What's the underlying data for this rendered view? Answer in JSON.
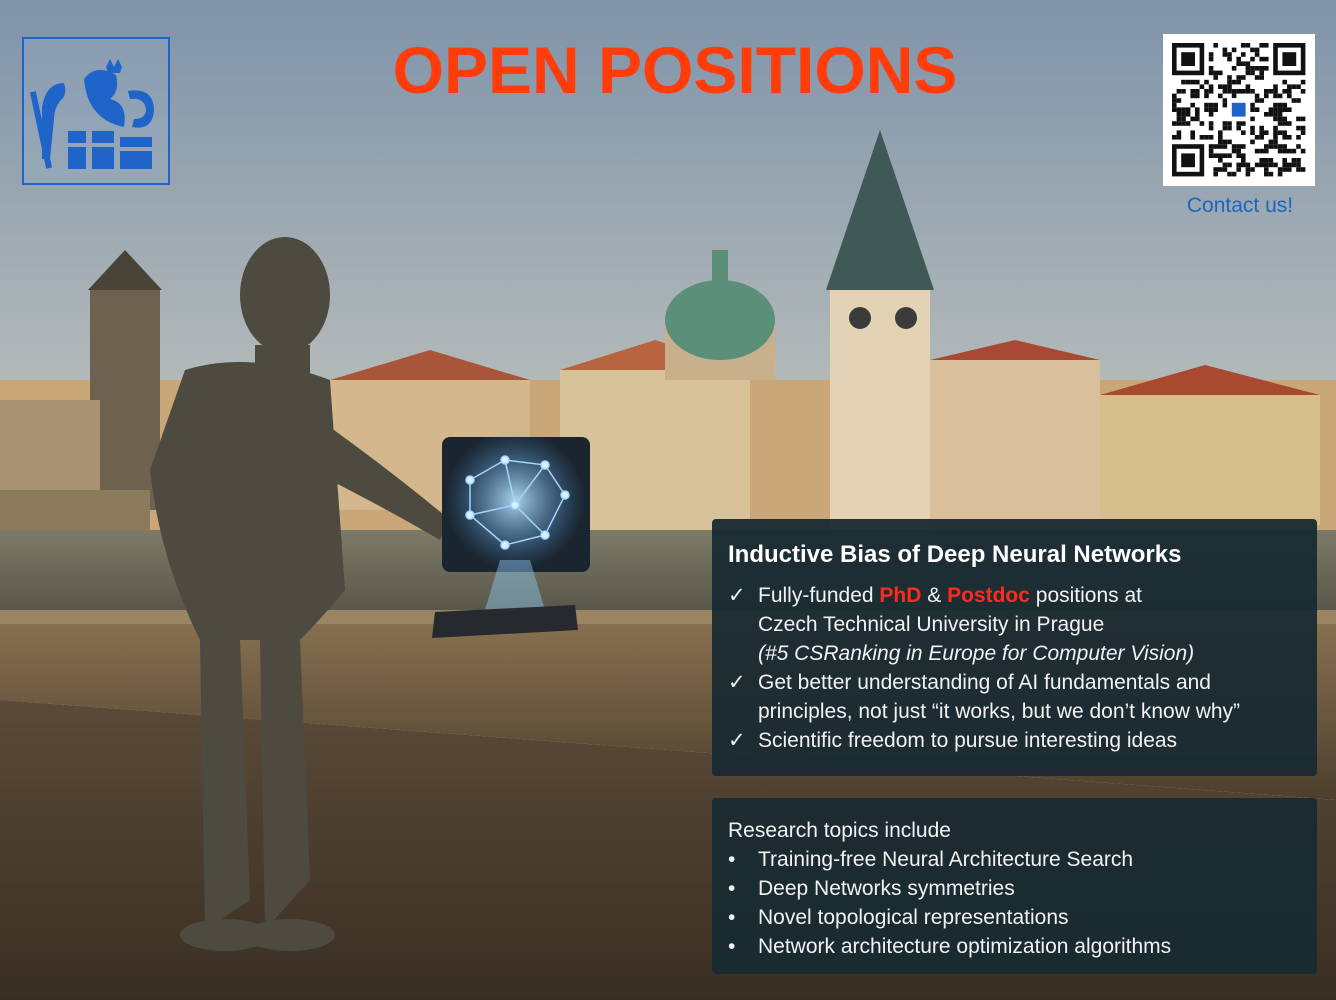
{
  "poster": {
    "headline": "OPEN POSITIONS",
    "contact_link": "Contact us!",
    "accent_color": "#ff3c0a",
    "link_color": "#1a66c4"
  },
  "intro_panel": {
    "title": "Inductive Bias of Deep Neural Networks",
    "check_mark": "✓",
    "point_1": {
      "before": "Fully-funded ",
      "phd": "PhD",
      "amp": " & ",
      "postdoc": "Postdoc",
      "after": " positions at",
      "line_2": "Czech Technical University in Prague",
      "line_3": "(#5 CSRanking in Europe for Computer Vision)"
    },
    "point_2": {
      "line_1": "Get better understanding of AI fundamentals and",
      "line_2": "principles, not just “it works, but we don’t know why”"
    },
    "point_3": "Scientific freedom to pursue interesting ideas"
  },
  "topics_panel": {
    "label": "Research topics include",
    "bullet": "•",
    "topics": [
      "Training-free Neural Architecture Search",
      "Deep Networks symmetries",
      "Novel topological representations",
      "Network architecture optimization algorithms"
    ]
  }
}
